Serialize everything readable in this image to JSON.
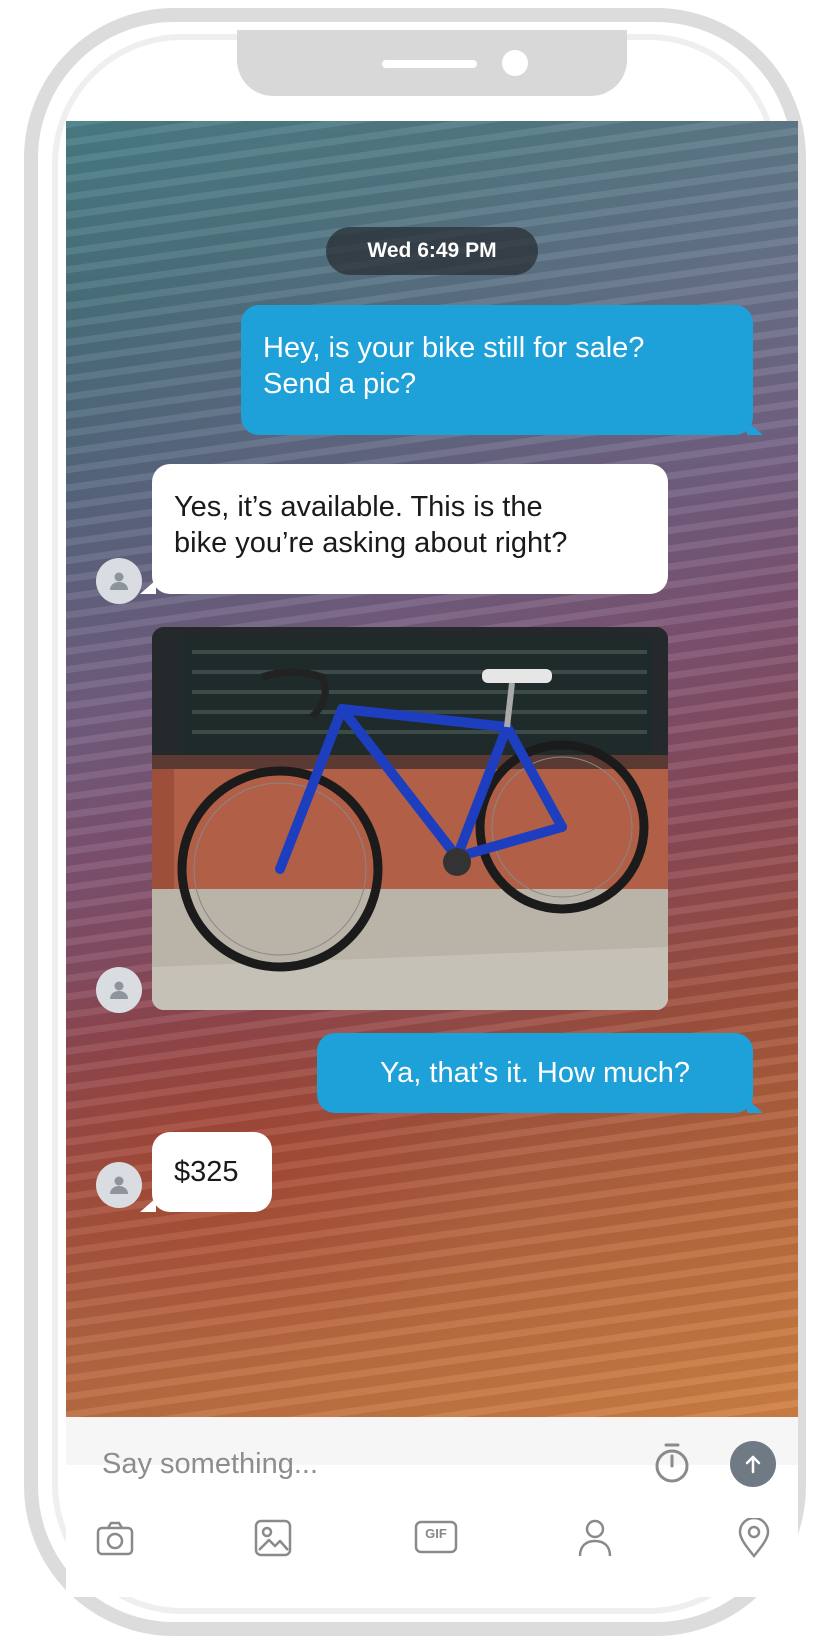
{
  "conversation": {
    "timestamp": "Wed 6:49 PM",
    "messages": [
      {
        "direction": "outgoing",
        "lines": [
          "Hey, is your bike still for sale?",
          "Send a pic?"
        ]
      },
      {
        "direction": "incoming",
        "lines": [
          "Yes, it’s available. This is the",
          "bike you’re asking about right?"
        ]
      },
      {
        "direction": "incoming",
        "type": "photo",
        "subject": "blue road bicycle leaning against a brick wall"
      },
      {
        "direction": "outgoing",
        "lines": [
          "Ya, that’s it. How much?"
        ]
      },
      {
        "direction": "incoming",
        "lines": [
          "$325"
        ]
      }
    ]
  },
  "composer": {
    "placeholder": "Say something...",
    "icons": {
      "timer": "timer-icon",
      "send": "send-arrow-icon",
      "camera": "camera-icon",
      "photo": "photo-gallery-icon",
      "gif": "gif-icon",
      "contact": "contact-person-icon",
      "location": "location-pin-icon"
    },
    "gif_label": "GIF"
  },
  "colors": {
    "outgoing_bubble": "#1ea0d8",
    "incoming_bubble": "#ffffff",
    "timestamp_pill": "#33383d",
    "send_button": "#707a84"
  }
}
